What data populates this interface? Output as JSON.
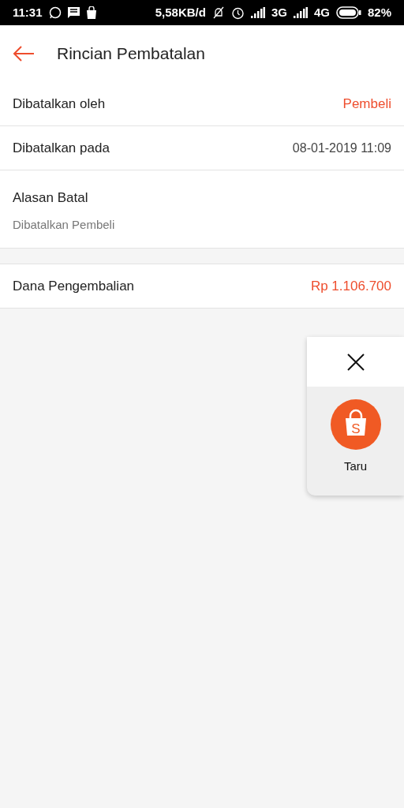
{
  "status_bar": {
    "time": "11:31",
    "speed": "5,58KB/d",
    "network_1": "3G",
    "network_2": "4G",
    "battery": "82%"
  },
  "header": {
    "title": "Rincian Pembatalan"
  },
  "details": [
    {
      "kind": "inline",
      "label": "Dibatalkan oleh",
      "value": "Pembeli",
      "highlight": true
    },
    {
      "kind": "inline",
      "label": "Dibatalkan pada",
      "value": "08-01-2019 11:09",
      "highlight": false
    },
    {
      "kind": "stacked",
      "label": "Alasan Batal",
      "value": "Dibatalkan Pembeli",
      "highlight": false
    }
  ],
  "refund": {
    "label": "Dana Pengembalian",
    "value": "Rp 1.106.700",
    "highlight": true
  },
  "floating_widget": {
    "logo_letter": "S",
    "label": "Taru"
  }
}
